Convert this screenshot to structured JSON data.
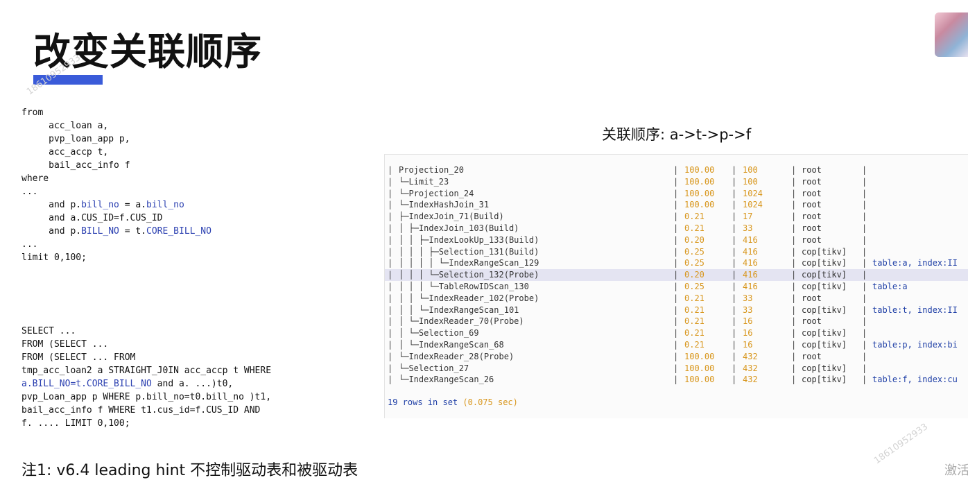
{
  "title": "改变关联顺序",
  "sql1": {
    "l1": "from",
    "l2": "     acc_loan a,",
    "l3": "     pvp_loan_app p,",
    "l4": "     acc_accp t,",
    "l5": "     bail_acc_info f",
    "l6": "where",
    "l7": "...",
    "l8a": "     and p.",
    "l8b": "bill_no",
    "l8c": " = a.",
    "l8d": "bill_no",
    "l9": "     and a.CUS_ID=f.CUS_ID",
    "l10a": "     and p.",
    "l10b": "BILL_NO",
    "l10c": " = t.",
    "l10d": "CORE_BILL_NO",
    "l11": "...",
    "l12": "limit 0,100;"
  },
  "sql2": {
    "l1": "SELECT ...",
    "l2": "FROM (SELECT ...",
    "l3": "FROM (SELECT ... FROM",
    "l4": "tmp_acc_loan2 a STRAIGHT_J0IN acc_accp t WHERE",
    "l5a": "a.BILL_NO=t.CORE_BILL_NO",
    "l5b": " and a. ...)t0,",
    "l6": "pvp_Loan_app p WHERE p.bill_no=t0.bill_no )t1,",
    "l7": "bail_acc_info f WHERE t1.cus_id=f.CUS_ID AND",
    "l8": "f. .... LIMIT 0,100;"
  },
  "join_order": "关联顺序:  a->t->p->f",
  "plan": {
    "rows": [
      {
        "id": "Projection_20",
        "est": "100.00",
        "act": "100",
        "task": "root",
        "info": ""
      },
      {
        "id": "└─Limit_23",
        "est": "100.00",
        "act": "100",
        "task": "root",
        "info": ""
      },
      {
        "id": "  └─Projection_24",
        "est": "100.00",
        "act": "1024",
        "task": "root",
        "info": ""
      },
      {
        "id": "    └─IndexHashJoin_31",
        "est": "100.00",
        "act": "1024",
        "task": "root",
        "info": ""
      },
      {
        "id": "      ├─IndexJoin_71(Build)",
        "est": "0.21",
        "act": "17",
        "task": "root",
        "info": ""
      },
      {
        "id": "      │ ├─IndexJoin_103(Build)",
        "est": "0.21",
        "act": "33",
        "task": "root",
        "info": ""
      },
      {
        "id": "      │ │ ├─IndexLookUp_133(Build)",
        "est": "0.20",
        "act": "416",
        "task": "root",
        "info": ""
      },
      {
        "id": "      │ │ │ ├─Selection_131(Build)",
        "est": "0.25",
        "act": "416",
        "task": "cop[tikv]",
        "info": ""
      },
      {
        "id": "      │ │ │ │ └─IndexRangeScan_129",
        "est": "0.25",
        "act": "416",
        "task": "cop[tikv]",
        "info": "table:a, index:II"
      },
      {
        "id": "      │ │ │ └─Selection_132(Probe)",
        "est": "0.20",
        "act": "416",
        "task": "cop[tikv]",
        "info": ""
      },
      {
        "id": "      │ │ │   └─TableRowIDScan_130",
        "est": "0.25",
        "act": "416",
        "task": "cop[tikv]",
        "info": "table:a"
      },
      {
        "id": "      │ │ └─IndexReader_102(Probe)",
        "est": "0.21",
        "act": "33",
        "task": "root",
        "info": ""
      },
      {
        "id": "      │ │   └─IndexRangeScan_101",
        "est": "0.21",
        "act": "33",
        "task": "cop[tikv]",
        "info": "table:t, index:II"
      },
      {
        "id": "      │ └─IndexReader_70(Probe)",
        "est": "0.21",
        "act": "16",
        "task": "root",
        "info": ""
      },
      {
        "id": "      │   └─Selection_69",
        "est": "0.21",
        "act": "16",
        "task": "cop[tikv]",
        "info": ""
      },
      {
        "id": "      │     └─IndexRangeScan_68",
        "est": "0.21",
        "act": "16",
        "task": "cop[tikv]",
        "info": "table:p, index:bi"
      },
      {
        "id": "      └─IndexReader_28(Probe)",
        "est": "100.00",
        "act": "432",
        "task": "root",
        "info": ""
      },
      {
        "id": "        └─Selection_27",
        "est": "100.00",
        "act": "432",
        "task": "cop[tikv]",
        "info": ""
      },
      {
        "id": "          └─IndexRangeScan_26",
        "est": "100.00",
        "act": "432",
        "task": "cop[tikv]",
        "info": "table:f, index:cu"
      }
    ],
    "highlight_row": 9,
    "footer_count": "19 rows in set",
    "footer_time": "(0.075 sec)"
  },
  "note": "注1: v6.4 leading hint 不控制驱动表和被驱动表",
  "watermark": "18610952933",
  "corner_text": "激活",
  "colors": {
    "accent_bar": "#3a5bd9",
    "sql_highlight": "#2a3fb0",
    "plan_numbers": "#d8961c",
    "plan_info": "#1f3fa6"
  }
}
